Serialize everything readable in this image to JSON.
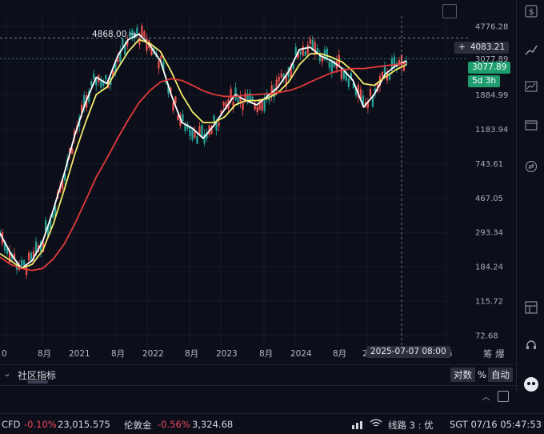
{
  "chart_data": {
    "type": "candlestick",
    "y_scale": "log",
    "ylim": [
      63,
      5500
    ],
    "y_ticks": [
      4776.28,
      3077.89,
      1884.99,
      1183.94,
      743.61,
      467.05,
      293.34,
      184.24,
      115.72,
      72.68
    ],
    "x_ticks": [
      "0",
      "8月",
      "2021",
      "8月",
      "2022",
      "8月",
      "2023",
      "8月",
      "2024",
      "8月",
      "20",
      "26"
    ],
    "crosshair_time": "2025-07-07 08:00",
    "crosshair_price": "4083.21",
    "last_price": "3077.89",
    "countdown": "5d 3h",
    "max_annotation": "4868.00 →",
    "series": [
      {
        "color": "#ffffff",
        "values": [
          290,
          220,
          180,
          200,
          260,
          400,
          650,
          1100,
          1700,
          2400,
          2200,
          3200,
          4000,
          4300,
          3700,
          3000,
          1900,
          1300,
          1200,
          1050,
          1250,
          1550,
          1900,
          1750,
          1650,
          1850,
          2100,
          2600,
          3500,
          3600,
          3200,
          3000,
          2700,
          2300,
          1600,
          1900,
          2500,
          2800,
          3000
        ]
      },
      {
        "color": "#f3e96b",
        "values": [
          220,
          200,
          180,
          190,
          230,
          330,
          520,
          850,
          1300,
          1900,
          2100,
          2700,
          3400,
          4000,
          3800,
          3400,
          2600,
          1900,
          1500,
          1300,
          1300,
          1400,
          1650,
          1750,
          1750,
          1800,
          1950,
          2250,
          2850,
          3300,
          3300,
          3150,
          2950,
          2600,
          2200,
          2150,
          2400,
          2650,
          2850
        ]
      },
      {
        "color": "#e23a3a",
        "values": [
          210,
          190,
          180,
          175,
          180,
          205,
          250,
          330,
          450,
          620,
          800,
          1050,
          1350,
          1700,
          2000,
          2250,
          2350,
          2300,
          2150,
          2000,
          1900,
          1850,
          1850,
          1880,
          1900,
          1920,
          1950,
          2000,
          2100,
          2250,
          2400,
          2550,
          2650,
          2700,
          2700,
          2750,
          2800,
          2850,
          2900
        ]
      }
    ]
  },
  "ui": {
    "bottom_label": "社区指标",
    "btn_log": "对数",
    "btn_pct": "%",
    "btn_auto": "自动",
    "right_labels": "筹 爆"
  },
  "status": {
    "item1_name": "CFD",
    "item1_change": "-0.10%",
    "item1_value": "23,015.575",
    "item2_name": "伦敦金",
    "item2_change": "-0.56%",
    "item2_value": "3,324.68",
    "line": "线路 3 : 优",
    "time": "SGT 07/16 05:47:53"
  },
  "colors": {
    "up": "#26a69a",
    "down": "#ef5350",
    "accent": "#1f9d6e"
  }
}
